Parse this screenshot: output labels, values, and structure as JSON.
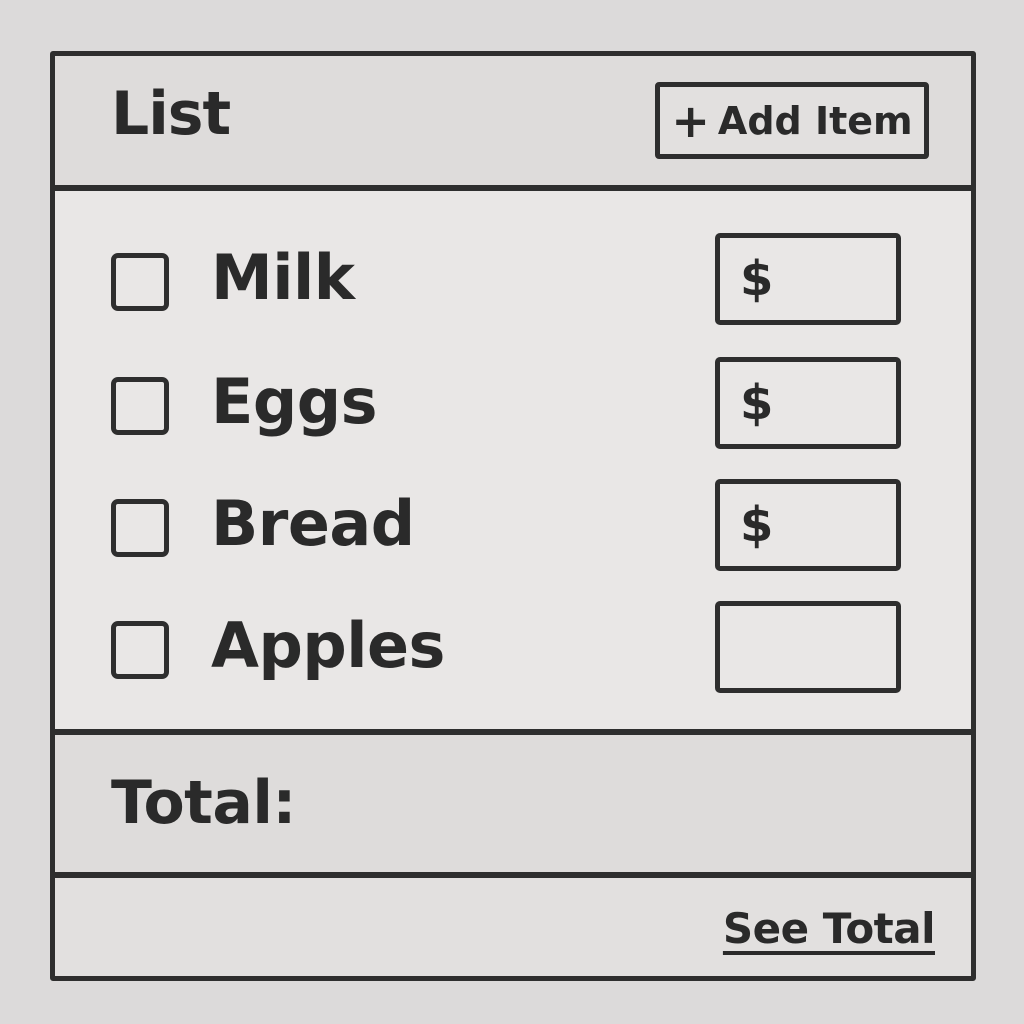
{
  "header": {
    "title": "List",
    "add_button": {
      "icon": "plus-icon",
      "icon_glyph": "+",
      "label": "Add Item"
    }
  },
  "items": [
    {
      "label": "Milk",
      "checked": false,
      "price_value": "$"
    },
    {
      "label": "Eggs",
      "checked": false,
      "price_value": "$"
    },
    {
      "label": "Bread",
      "checked": false,
      "price_value": "$"
    },
    {
      "label": "Apples",
      "checked": false,
      "price_value": ""
    }
  ],
  "total": {
    "label": "Total:",
    "value": ""
  },
  "footer": {
    "see_total_label": "See Total"
  }
}
